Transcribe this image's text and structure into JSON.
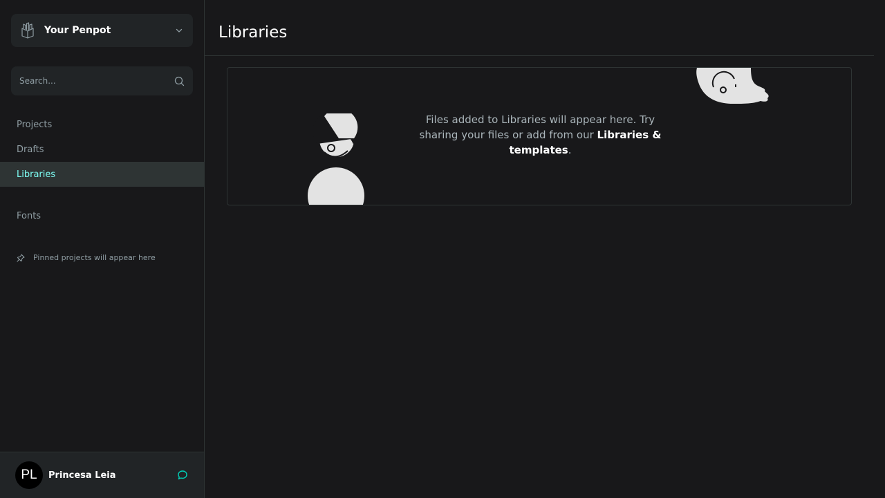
{
  "sidebar": {
    "team_name": "Your Penpot",
    "search_placeholder": "Search...",
    "nav": {
      "projects": "Projects",
      "drafts": "Drafts",
      "libraries": "Libraries",
      "fonts": "Fonts"
    },
    "pinned_text": "Pinned projects will appear here"
  },
  "profile": {
    "initials": "PL",
    "name": "Princesa Leia"
  },
  "main": {
    "title": "Libraries",
    "empty_text_before": "Files added to Libraries will appear here. Try sharing your files or add from our ",
    "empty_link": "Libraries & templates",
    "empty_text_after": "."
  },
  "colors": {
    "background": "#18181a",
    "panel": "#212426",
    "accent": "#7efff5",
    "active_bg": "#2e3434",
    "muted_text": "#8f9da3"
  },
  "icons": [
    "penpot-logo-icon",
    "chevron-down-icon",
    "search-icon",
    "pin-icon",
    "comments-icon"
  ]
}
